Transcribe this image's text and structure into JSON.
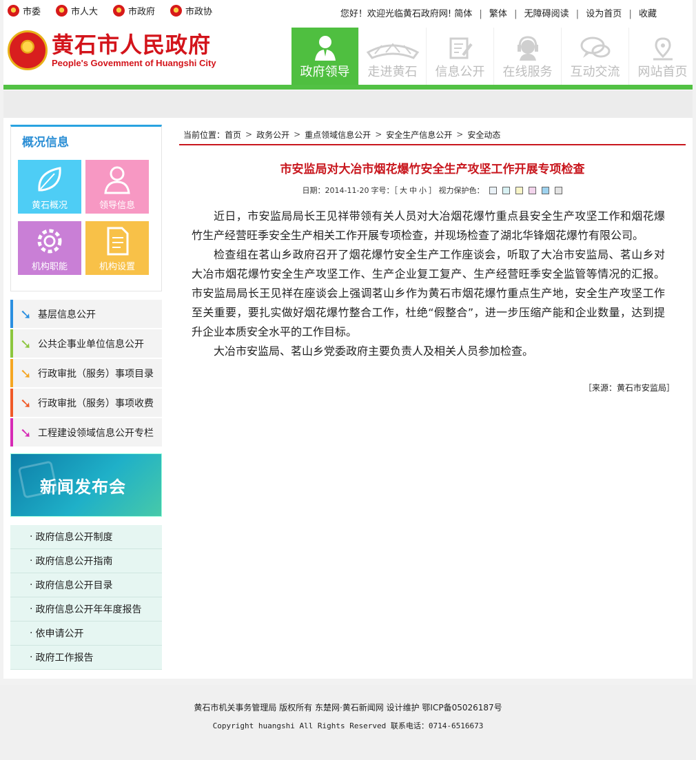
{
  "topbar": {
    "links": [
      {
        "label": "市委"
      },
      {
        "label": "市人大"
      },
      {
        "label": "市政府"
      },
      {
        "label": "市政协"
      }
    ],
    "welcome": "您好！欢迎光临黄石政府网!",
    "right_links": [
      "简体",
      "繁体",
      "无障碍阅读",
      "设为首页",
      "收藏"
    ]
  },
  "header": {
    "logo_cn": "黄石市人民政府",
    "logo_en": "People's Govemment of Huangshi City",
    "nav": [
      {
        "label": "政府领导",
        "icon": "person-icon",
        "active": true
      },
      {
        "label": "走进黄石",
        "icon": "stadium-icon",
        "active": false
      },
      {
        "label": "信息公开",
        "icon": "document-edit-icon",
        "active": false
      },
      {
        "label": "在线服务",
        "icon": "headset-icon",
        "active": false
      },
      {
        "label": "互动交流",
        "icon": "chat-bubbles-icon",
        "active": false
      },
      {
        "label": "网站首页",
        "icon": "location-pin-icon",
        "active": false
      }
    ]
  },
  "sidebar": {
    "overview_title": "概况信息",
    "tiles": [
      {
        "label": "黄石概况",
        "icon": "leaf-icon"
      },
      {
        "label": "领导信息",
        "icon": "user-icon"
      },
      {
        "label": "机构职能",
        "icon": "gear-icon"
      },
      {
        "label": "机构设置",
        "icon": "document-icon"
      }
    ],
    "categories": [
      {
        "label": "基层信息公开",
        "color": "#2b8fe0"
      },
      {
        "label": "公共企事业单位信息公开",
        "color": "#8cc63e"
      },
      {
        "label": "行政审批（服务）事项目录",
        "color": "#f5a623"
      },
      {
        "label": "行政审批（服务）事项收费",
        "color": "#f05a28"
      },
      {
        "label": "工程建设领域信息公开专栏",
        "color": "#d62ab5"
      }
    ],
    "banner": "新闻发布会",
    "info_links": [
      "政府信息公开制度",
      "政府信息公开指南",
      "政府信息公开目录",
      "政府信息公开年年度报告",
      "依申请公开",
      "政府工作报告"
    ]
  },
  "main": {
    "crumb_prefix": "当前位置：",
    "crumbs": [
      "首页",
      "政务公开",
      "重点领域信息公开",
      "安全生产信息公开",
      "安全动态"
    ],
    "title": "市安监局对大冶市烟花爆竹安全生产攻坚工作开展专项检查",
    "date": "日期：2014-11-20",
    "font_size_label": "字号：［",
    "font_sizes": [
      "大",
      "中",
      "小"
    ],
    "eye_label": "］ 视力保护色：",
    "swatches": [
      "#e9f1f6",
      "#d8f1f3",
      "#f8f5c8",
      "#f2d4ec",
      "#9ed2ee",
      "#e4e4e4"
    ],
    "paragraphs": [
      "近日，市安监局局长王见祥带领有关人员对大冶烟花爆竹重点县安全生产攻坚工作和烟花爆竹生产经营旺季安全生产相关工作开展专项检查，并现场检查了湖北华锋烟花爆竹有限公司。",
      "检查组在茗山乡政府召开了烟花爆竹安全生产工作座谈会，听取了大冶市安监局、茗山乡对大冶市烟花爆竹安全生产攻坚工作、生产企业复工复产、生产经营旺季安全监管等情况的汇报。市安监局局长王见祥在座谈会上强调茗山乡作为黄石市烟花爆竹重点生产地，安全生产攻坚工作至关重要，要扎实做好烟花爆竹整合工作，杜绝“假整合”，进一步压缩产能和企业数量，达到提升企业本质安全水平的工作目标。",
      "大冶市安监局、茗山乡党委政府主要负责人及相关人员参加检查。"
    ],
    "source": "［来源：黄石市安监局］"
  },
  "footer": {
    "line1": "黄石市机关事务管理局 版权所有 东楚网·黄石新闻网 设计维护 鄂ICP备05026187号",
    "line2": "Copyright huangshi All Rights Reserved  联系电话：0714-6516673"
  }
}
